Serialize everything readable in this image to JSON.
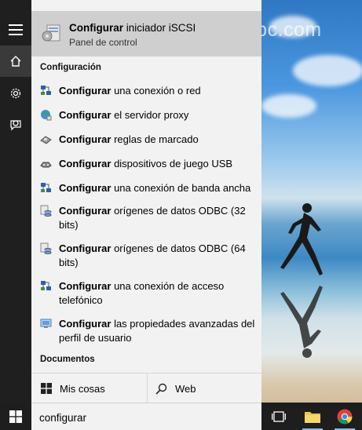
{
  "watermark": "norfipc.com",
  "top_match": {
    "title_bold": "Configurar",
    "title_rest": " iniciador iSCSI",
    "subtitle": "Panel de control"
  },
  "sections": {
    "settings": "Configuración",
    "documents": "Documentos"
  },
  "results": [
    {
      "bold": "Configurar",
      "rest": " una conexión o red",
      "icon": "network-icon"
    },
    {
      "bold": "Configurar",
      "rest": " el servidor proxy",
      "icon": "globe-icon"
    },
    {
      "bold": "Configurar",
      "rest": " reglas de marcado",
      "icon": "phone-icon"
    },
    {
      "bold": "Configurar",
      "rest": " dispositivos de juego USB",
      "icon": "gamepad-icon"
    },
    {
      "bold": "Configurar",
      "rest": " una conexión de banda ancha",
      "icon": "network-icon"
    },
    {
      "bold": "Configurar",
      "rest": " orígenes de datos ODBC (32 bits)",
      "icon": "database-icon"
    },
    {
      "bold": "Configurar",
      "rest": " orígenes de datos ODBC (64 bits)",
      "icon": "database-icon"
    },
    {
      "bold": "Configurar",
      "rest": " una conexión de acceso telefónico",
      "icon": "network-icon"
    },
    {
      "bold": "Configurar",
      "rest": " las propiedades avanzadas del perfil de usuario",
      "icon": "monitor-icon"
    }
  ],
  "bottom": {
    "my_stuff": "Mis cosas",
    "web": "Web"
  },
  "search": {
    "value": "configurar"
  }
}
